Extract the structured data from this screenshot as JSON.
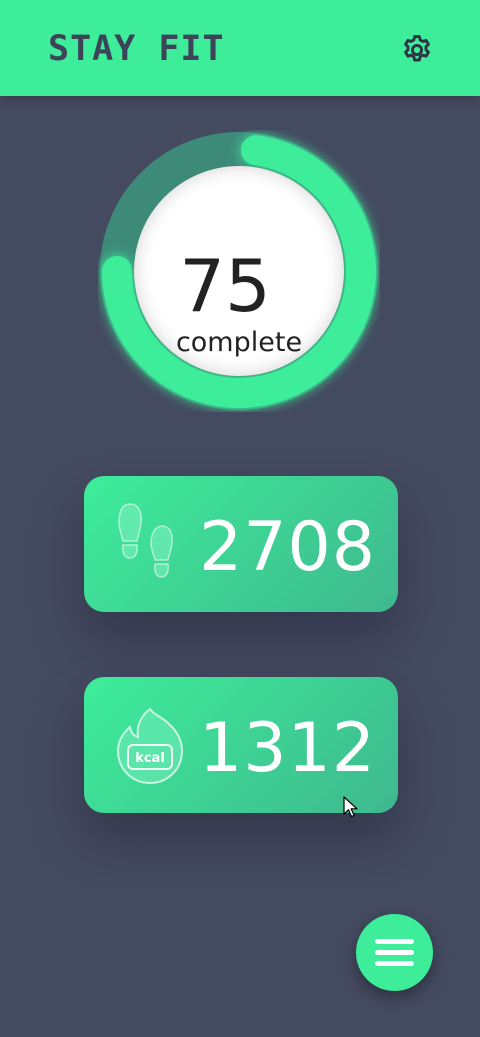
{
  "header": {
    "title": "STAY FIT",
    "settings_icon": "gear-icon"
  },
  "progress": {
    "value": "75",
    "label": "complete",
    "percent": 75
  },
  "stats": {
    "steps": {
      "icon": "footsteps-icon",
      "value": "2708"
    },
    "calories": {
      "icon": "kcal-flame-icon",
      "icon_text": "kcal",
      "value": "1312"
    }
  },
  "fab": {
    "icon": "hamburger-menu-icon"
  },
  "colors": {
    "accent": "#3ded9a",
    "accent_dark": "#3fb88f",
    "background": "#444a60",
    "header_text": "#3d4458"
  }
}
